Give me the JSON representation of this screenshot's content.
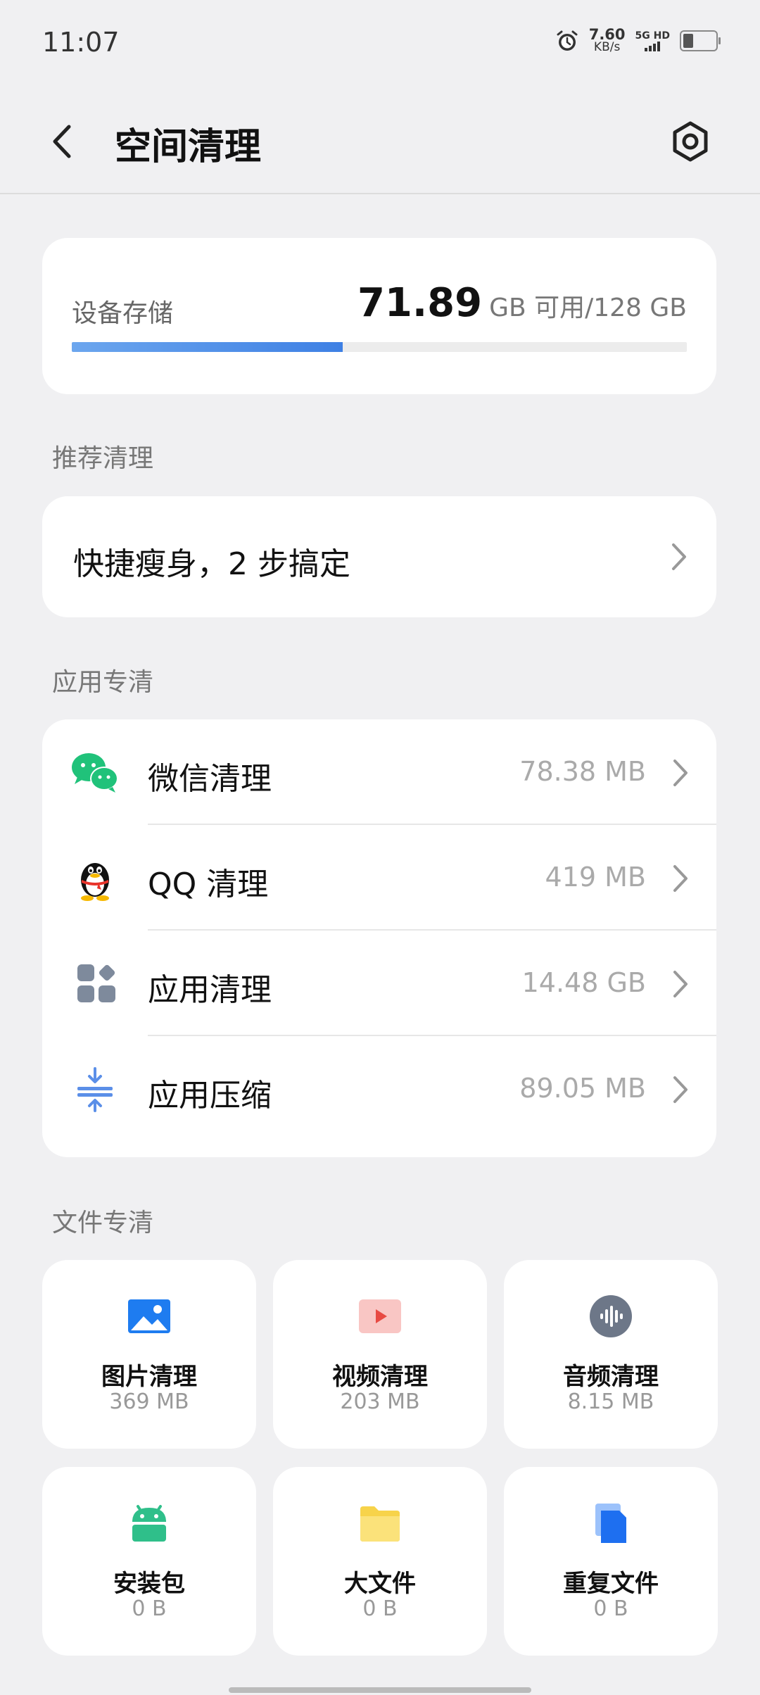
{
  "status_bar": {
    "time": "11:07",
    "net_speed_value": "7.60",
    "net_speed_unit": "KB/s",
    "network_type": "5G HD",
    "battery_level": 0.35
  },
  "header": {
    "title": "空间清理"
  },
  "storage": {
    "label": "设备存储",
    "available": "71.89",
    "unit_text": "GB 可用/128 GB",
    "used_fraction": 0.44
  },
  "recommend": {
    "section_title": "推荐清理",
    "label": "快捷瘦身，2 步搞定"
  },
  "app_clean": {
    "section_title": "应用专清",
    "items": [
      {
        "name": "微信清理",
        "size": "78.38 MB",
        "icon": "wechat-icon"
      },
      {
        "name": "QQ 清理",
        "size": "419 MB",
        "icon": "qq-icon"
      },
      {
        "name": "应用清理",
        "size": "14.48 GB",
        "icon": "apps-grid-icon"
      },
      {
        "name": "应用压缩",
        "size": "89.05 MB",
        "icon": "compress-icon"
      }
    ]
  },
  "file_clean": {
    "section_title": "文件专清",
    "tiles": [
      {
        "name": "图片清理",
        "size": "369 MB",
        "icon": "image-icon"
      },
      {
        "name": "视频清理",
        "size": "203 MB",
        "icon": "video-icon"
      },
      {
        "name": "音频清理",
        "size": "8.15 MB",
        "icon": "audio-icon"
      },
      {
        "name": "安装包",
        "size": "0 B",
        "icon": "android-icon"
      },
      {
        "name": "大文件",
        "size": "0 B",
        "icon": "folder-icon"
      },
      {
        "name": "重复文件",
        "size": "0 B",
        "icon": "duplicate-file-icon"
      }
    ]
  },
  "colors": {
    "background": "#f0f0f2",
    "accent_blue": "#3e80e4",
    "wechat_green": "#2dc100",
    "muted_text": "#aaaaaa"
  }
}
